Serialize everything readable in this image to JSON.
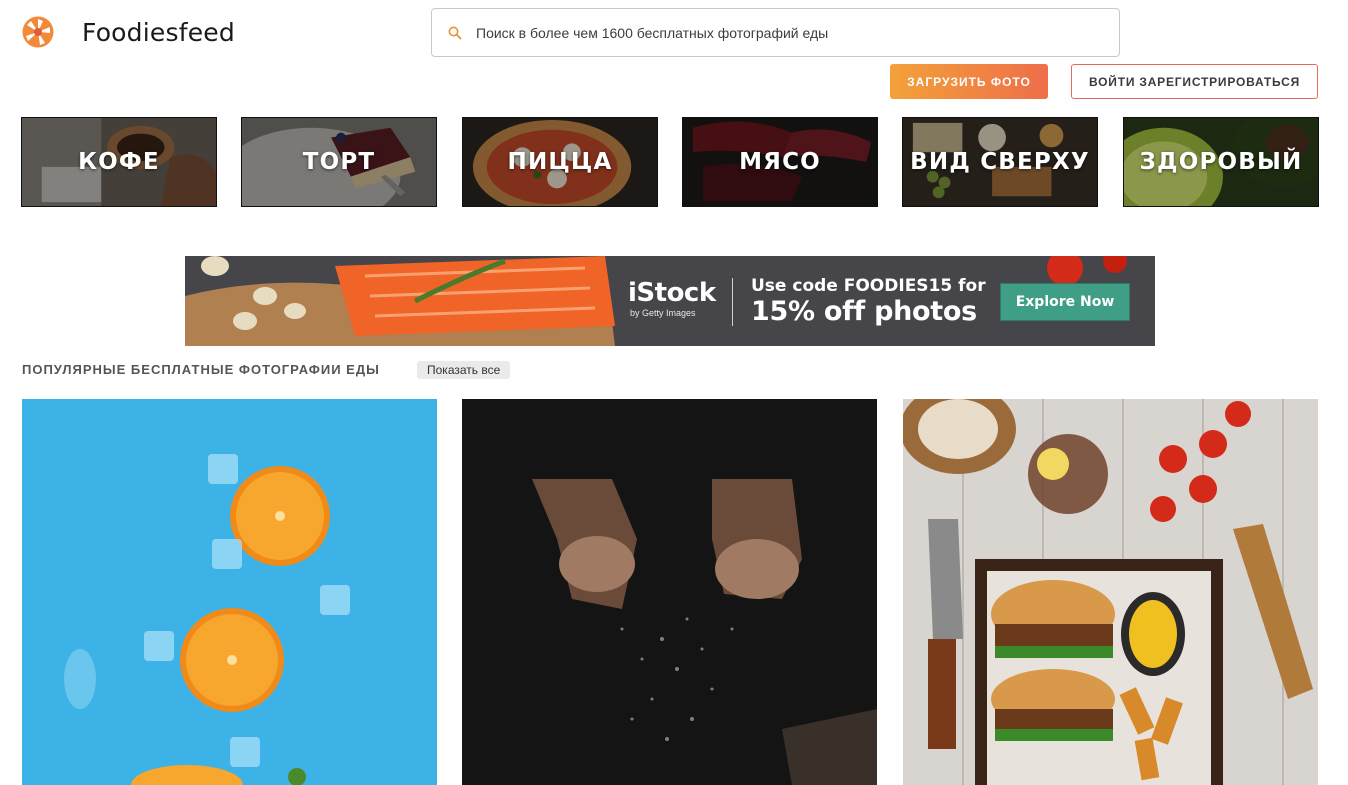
{
  "header": {
    "logo_text": "Foodiesfeed",
    "logo_icon": "aperture-logo-icon",
    "search_placeholder": "Поиск в более чем 1600 бесплатных фотографий еды",
    "search_icon": "search-icon",
    "upload_label": "ЗАГРУЗИТЬ ФОТО",
    "login_label": "ВОЙТИ ЗАРЕГИСТРИРОВАТЬСЯ"
  },
  "categories": [
    {
      "label": "КОФЕ"
    },
    {
      "label": "ТОРТ"
    },
    {
      "label": "ПИЦЦА"
    },
    {
      "label": "МЯСО"
    },
    {
      "label": "ВИД СВЕРХУ"
    },
    {
      "label": "ЗДОРОВЫЙ"
    }
  ],
  "banner": {
    "brand": "iStock",
    "brand_sub": "by Getty Images",
    "line1": "Use code FOODIES15 for",
    "line2": "15% off photos",
    "button": "Explore Now"
  },
  "section": {
    "title": "ПОПУЛЯРНЫЕ БЕСПЛАТНЫЕ ФОТОГРАФИИ ЕДЫ",
    "show_all": "Показать все"
  },
  "colors": {
    "accent_gradient_start": "#f3a13a",
    "accent_gradient_end": "#ee6e4a",
    "banner_button": "#3f9e86"
  }
}
